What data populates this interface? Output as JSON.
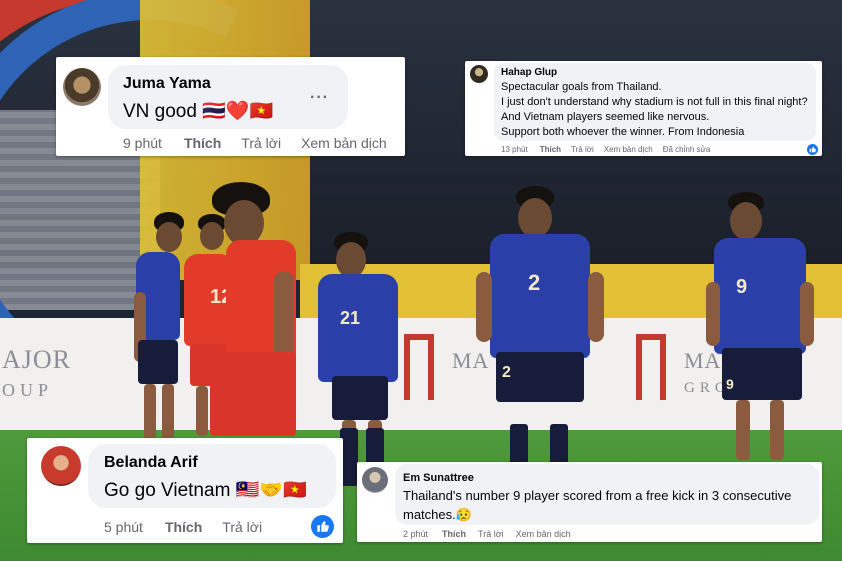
{
  "photo": {
    "boards": {
      "left_logo": "AJOR",
      "left_logo_sub": "OUP",
      "right_logo_1": "MA",
      "right_logo_2": "MA",
      "right_logo_sub": "GRO"
    },
    "jersey_numbers": {
      "red_player_left": "12",
      "blue_player_1": "21",
      "blue_player_2": "2",
      "blue_player_2_shorts": "2",
      "blue_player_3": "9",
      "blue_player_3_shorts": "9"
    }
  },
  "comments": [
    {
      "id": "juma",
      "author": "Juma Yama",
      "text": "VN good 🇹🇭❤️🇻🇳",
      "time": "9 phút",
      "like": "Thích",
      "reply": "Trả lời",
      "translate": "Xem bản dịch",
      "more": "···"
    },
    {
      "id": "hahap",
      "author": "Hahap Glup",
      "lines": [
        "Spectacular goals from Thailand.",
        "I just don't understand why stadium is not full in this final night?",
        "And Vietnam players seemed like nervous.",
        "Support both whoever the winner. From Indonesia"
      ],
      "time": "13 phút",
      "like": "Thích",
      "reply": "Trả lời",
      "translate": "Xem bản dịch",
      "edited": "Đã chỉnh sửa",
      "reaction_icon": "like-icon"
    },
    {
      "id": "belanda",
      "author": "Belanda Arif",
      "text": "Go go Vietnam 🇲🇾🤝🇻🇳",
      "time": "5 phút",
      "like": "Thích",
      "reply": "Trả lời",
      "reaction_icon": "like-icon"
    },
    {
      "id": "em",
      "author": "Em Sunattree",
      "lines": [
        "Thailand's number 9 player scored from a free kick in 3 consecutive",
        "matches.😥"
      ],
      "time": "2 phút",
      "like": "Thích",
      "reply": "Trả lời",
      "translate": "Xem bản dịch"
    }
  ],
  "colors": {
    "like_blue": "#1877f2",
    "bubble_gray": "#f0f2f5",
    "meta_gray": "#65676b",
    "thai_blue": "#2b3fa8",
    "vn_red": "#e23b2a"
  }
}
